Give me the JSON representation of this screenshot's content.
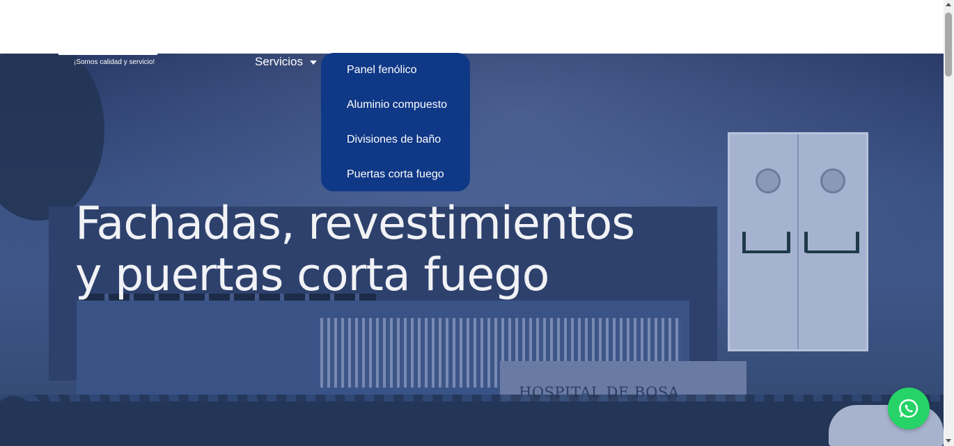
{
  "brand": {
    "tagline": "¡Somos calidad y servicio!"
  },
  "nav": {
    "servicios_label": "Servicios"
  },
  "dropdown": {
    "items": [
      {
        "label": "Panel fenólico"
      },
      {
        "label": "Aluminio compuesto"
      },
      {
        "label": "Divisiones de baño"
      },
      {
        "label": "Puertas corta fuego"
      }
    ]
  },
  "hero": {
    "headline_line1": "Fachadas, revestimientos",
    "headline_line2": "y puertas corta fuego",
    "sign_text": "HOSPITAL DE BOSA"
  },
  "whatsapp": {
    "icon": "whatsapp-icon",
    "color": "#25d366"
  },
  "colors": {
    "dropdown_bg": "#0f3886",
    "hero_overlay": "#3b5285"
  }
}
